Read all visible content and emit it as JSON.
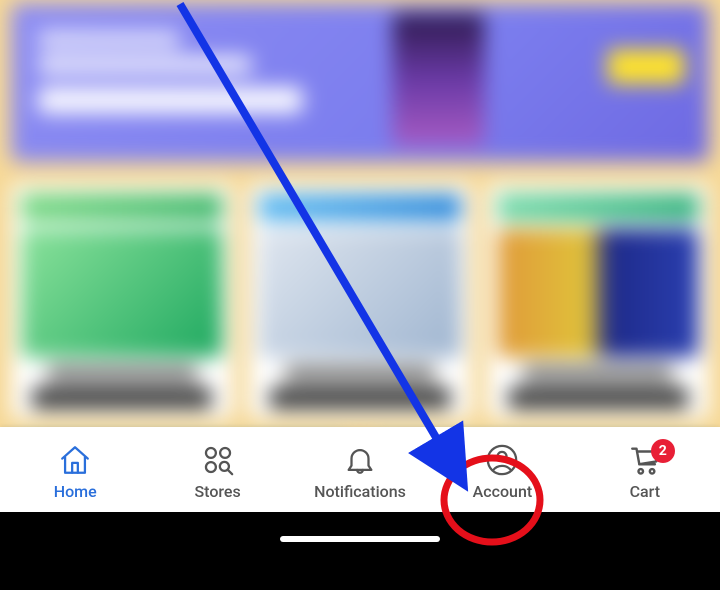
{
  "nav": {
    "home": {
      "label": "Home"
    },
    "stores": {
      "label": "Stores"
    },
    "notifications": {
      "label": "Notifications"
    },
    "account": {
      "label": "Account"
    },
    "cart": {
      "label": "Cart",
      "badge": "2"
    }
  }
}
